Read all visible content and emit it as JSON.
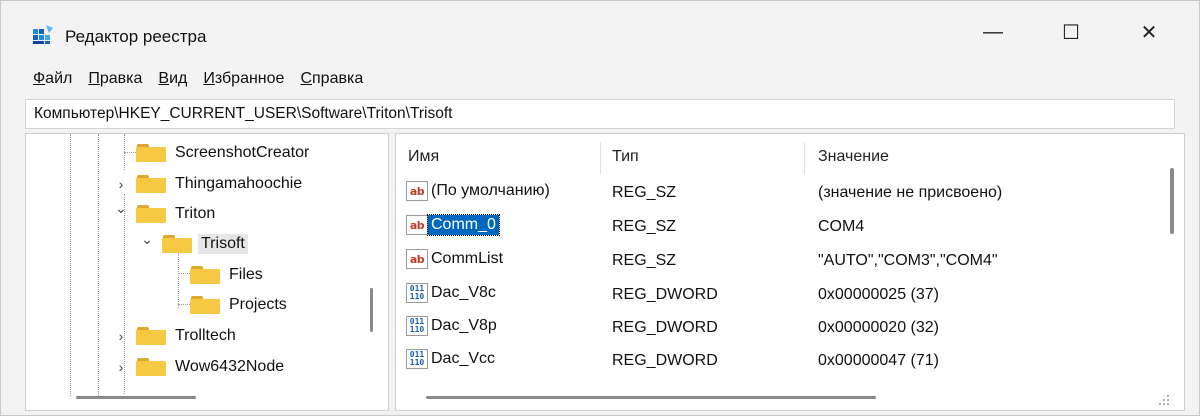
{
  "window": {
    "title": "Редактор реестра",
    "controls": {
      "minimize": "—",
      "maximize": "☐",
      "close": "✕"
    }
  },
  "menu": [
    {
      "accel": "Ф",
      "rest": "айл"
    },
    {
      "accel": "П",
      "rest": "равка"
    },
    {
      "accel": "В",
      "rest": "ид"
    },
    {
      "accel": "И",
      "rest": "збранное"
    },
    {
      "accel": "С",
      "rest": "правка"
    }
  ],
  "address": "Компьютер\\HKEY_CURRENT_USER\\Software\\Triton\\Trisoft",
  "tree": [
    {
      "label": "ScreenshotCreator",
      "expander": ""
    },
    {
      "label": "Thingamahoochie",
      "expander": "›"
    },
    {
      "label": "Triton",
      "expander": "⌄"
    },
    {
      "label": "Trisoft",
      "expander": "⌄",
      "selected": true
    },
    {
      "label": "Files",
      "expander": ""
    },
    {
      "label": "Projects",
      "expander": ""
    },
    {
      "label": "Trolltech",
      "expander": "›"
    },
    {
      "label": "Wow6432Node",
      "expander": "›"
    }
  ],
  "columns": {
    "name": "Имя",
    "type": "Тип",
    "value": "Значение"
  },
  "values": [
    {
      "icon": "string-value-icon",
      "name": "(По умолчанию)",
      "type": "REG_SZ",
      "data": "(значение не присвоено)"
    },
    {
      "icon": "string-value-icon",
      "name": "Comm_0",
      "type": "REG_SZ",
      "data": "COM4",
      "selected": true
    },
    {
      "icon": "string-value-icon",
      "name": "CommList",
      "type": "REG_SZ",
      "data": "\"AUTO\",\"COM3\",\"COM4\""
    },
    {
      "icon": "dword-value-icon",
      "name": "Dac_V8c",
      "type": "REG_DWORD",
      "data": "0x00000025 (37)"
    },
    {
      "icon": "dword-value-icon",
      "name": "Dac_V8p",
      "type": "REG_DWORD",
      "data": "0x00000020 (32)"
    },
    {
      "icon": "dword-value-icon",
      "name": "Dac_Vcc",
      "type": "REG_DWORD",
      "data": "0x00000047 (71)"
    }
  ],
  "icons": {
    "string": "ab",
    "dword_top": "011",
    "dword_bottom": "110"
  },
  "colors": {
    "selection": "#0067c0",
    "folder": "#f7c843"
  }
}
